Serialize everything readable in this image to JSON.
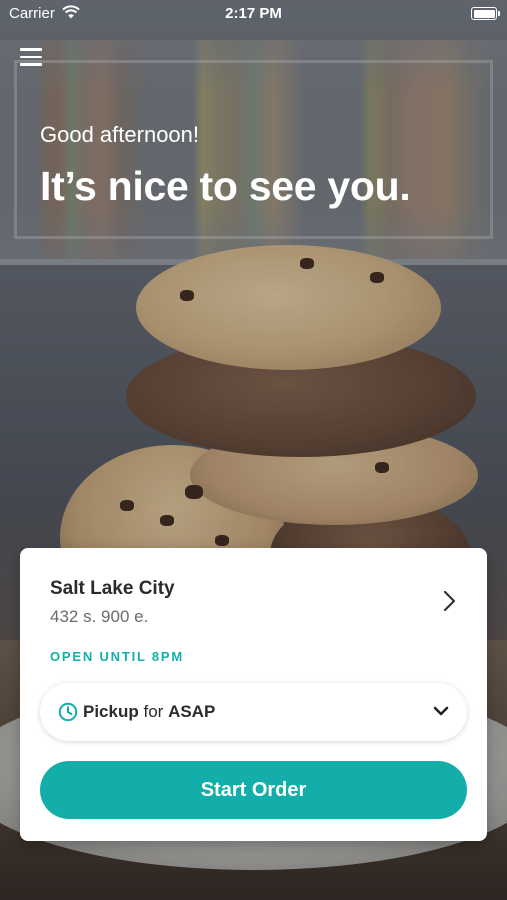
{
  "status_bar": {
    "carrier": "Carrier",
    "time": "2:17 PM"
  },
  "hero": {
    "greeting": "Good afternoon!",
    "headline": "It’s nice to see you."
  },
  "location_card": {
    "city": "Salt Lake City",
    "address": "432 s. 900 e.",
    "hours": "OPEN UNTIL 8PM",
    "pickup_label": "Pickup",
    "pickup_connector": "for",
    "pickup_time": "ASAP",
    "start_order_label": "Start Order"
  },
  "icons": {
    "menu": "hamburger-menu-icon",
    "wifi": "wifi-icon",
    "battery": "battery-icon",
    "location_chevron": "chevron-right-icon",
    "clock": "clock-icon",
    "dropdown_chevron": "chevron-down-icon"
  },
  "colors": {
    "accent": "#14aeaa",
    "card_background": "#ffffff",
    "text_primary": "#2b2b2b",
    "text_secondary": "#6b6b6b"
  }
}
